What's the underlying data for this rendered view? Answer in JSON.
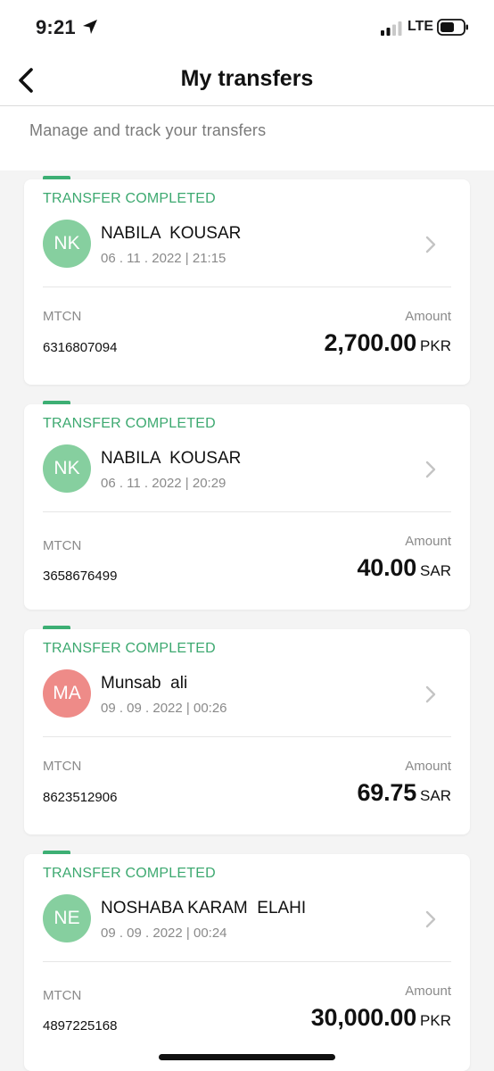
{
  "status_bar": {
    "time": "9:21",
    "network": "LTE",
    "icons": [
      "location-arrow-icon",
      "signal-icon",
      "battery-icon"
    ]
  },
  "header": {
    "title": "My transfers",
    "back_icon": "chevron-left-icon"
  },
  "subtitle": "Manage and track your transfers",
  "colors": {
    "accent_green": "#3da970",
    "avatar_green": "#86cf9f",
    "avatar_red": "#ee8b88"
  },
  "labels": {
    "mtcn": "MTCN",
    "amount": "Amount"
  },
  "transfers": [
    {
      "status": "TRANSFER COMPLETED",
      "initials": "NK",
      "avatar_color": "#86cf9f",
      "name": "NABILA  KOUSAR",
      "date": "06 . 11 . 2022 | 21:15",
      "mtcn": "6316807094",
      "amount": "2,700.00",
      "currency": "PKR"
    },
    {
      "status": "TRANSFER COMPLETED",
      "initials": "NK",
      "avatar_color": "#86cf9f",
      "name": "NABILA  KOUSAR",
      "date": "06 . 11 . 2022 | 20:29",
      "mtcn": "3658676499",
      "amount": "40.00",
      "currency": "SAR"
    },
    {
      "status": "TRANSFER COMPLETED",
      "initials": "MA",
      "avatar_color": "#ee8b88",
      "name": "Munsab  ali",
      "date": "09 . 09 . 2022 | 00:26",
      "mtcn": "8623512906",
      "amount": "69.75",
      "currency": "SAR"
    },
    {
      "status": "TRANSFER COMPLETED",
      "initials": "NE",
      "avatar_color": "#86cf9f",
      "name": "NOSHABA KARAM  ELAHI",
      "date": "09 . 09 . 2022 | 00:24",
      "mtcn": "4897225168",
      "amount": "30,000.00",
      "currency": "PKR"
    }
  ]
}
